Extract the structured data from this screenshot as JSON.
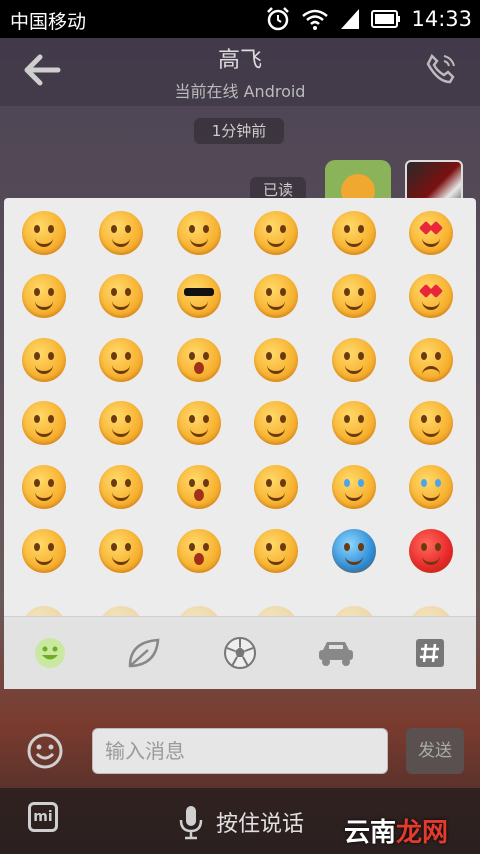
{
  "status_bar": {
    "carrier": "中国移动",
    "time": "14:33",
    "icons": [
      "alarm-icon",
      "wifi-icon",
      "signal-icon",
      "battery-icon"
    ]
  },
  "header": {
    "back_icon": "arrow-left-icon",
    "contact_name": "高飞",
    "presence": "当前在线 Android",
    "call_icon": "phone-icon"
  },
  "conversation": {
    "timestamp": "1分钟前",
    "read_status": "已读"
  },
  "emoji_panel": {
    "rows": [
      [
        "grin",
        "smile",
        "happy",
        "blush",
        "wink",
        "heart-eyes"
      ],
      [
        "kiss-note",
        "giggle",
        "cool",
        "tongue",
        "drool",
        "heart-drool"
      ],
      [
        "kiss-lips",
        "rose",
        "scared",
        "whistle",
        "confused",
        "wail"
      ],
      [
        "shy",
        "hands-cheeks",
        "sly",
        "fist",
        "dizzy",
        "hands-together"
      ],
      [
        "sparkle-eyes",
        "sweat-laugh",
        "puke",
        "bow",
        "cry",
        "tears"
      ],
      [
        "cap",
        "sprout",
        "yawn",
        "think",
        "blue",
        "angry"
      ]
    ],
    "tabs": [
      {
        "name": "smiley-icon",
        "active": true
      },
      {
        "name": "leaf-icon",
        "active": false
      },
      {
        "name": "soccer-ball-icon",
        "active": false
      },
      {
        "name": "car-icon",
        "active": false
      },
      {
        "name": "hash-icon",
        "active": false
      }
    ],
    "accent_color": "#6fad1e"
  },
  "composer": {
    "placeholder": "输入消息",
    "send_label": "发送"
  },
  "bottom_bar": {
    "mi_label": "mi",
    "hold_to_talk": "按住说话",
    "watermark_left": "云南",
    "watermark_right": "龙网"
  }
}
